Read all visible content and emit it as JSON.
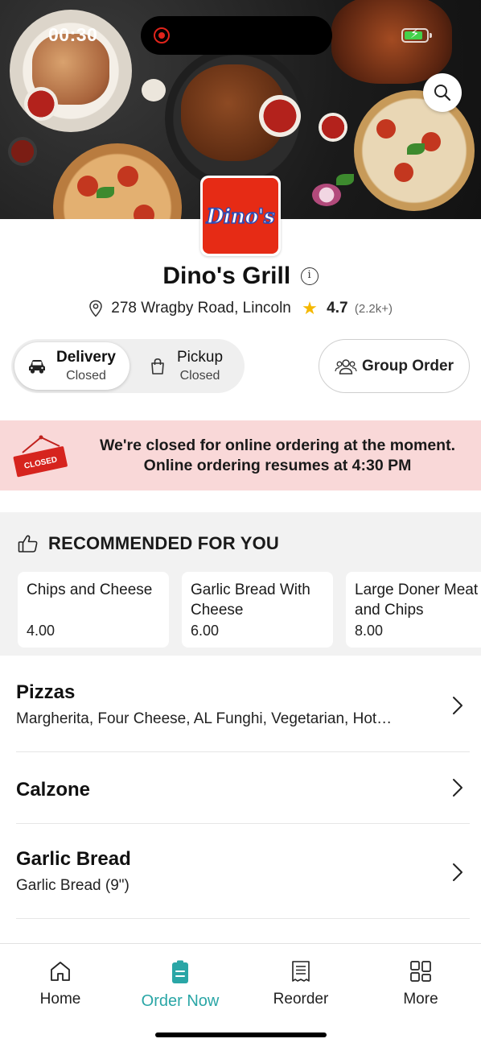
{
  "status_bar": {
    "time": "00:30"
  },
  "restaurant": {
    "name": "Dino's Grill",
    "logo_text": "Dino's",
    "address": "278 Wragby Road, Lincoln",
    "rating": "4.7",
    "rating_count": "(2.2k+)"
  },
  "order_mode": {
    "delivery": {
      "label": "Delivery",
      "status": "Closed",
      "selected": true
    },
    "pickup": {
      "label": "Pickup",
      "status": "Closed",
      "selected": false
    }
  },
  "group_order": {
    "label": "Group Order"
  },
  "closed_banner": {
    "sign_text": "CLOSED",
    "line1": "We're closed for online ordering at the moment.",
    "line2": "Online ordering resumes at 4:30 PM"
  },
  "recommended": {
    "title": "RECOMMENDED FOR YOU",
    "items": [
      {
        "name": "Chips and Cheese",
        "price": "4.00"
      },
      {
        "name": "Garlic Bread With Cheese",
        "price": "6.00"
      },
      {
        "name": "Large Doner Meat and Chips",
        "price": "8.00"
      }
    ]
  },
  "categories": [
    {
      "name": "Pizzas",
      "description": "Margherita, Four Cheese, AL Funghi, Vegetarian, Hot…"
    },
    {
      "name": "Calzone",
      "description": ""
    },
    {
      "name": "Garlic Bread",
      "description": "Garlic Bread (9\")"
    }
  ],
  "bottom_nav": {
    "items": [
      {
        "label": "Home",
        "icon": "home-icon",
        "active": false
      },
      {
        "label": "Order Now",
        "icon": "order-icon",
        "active": true
      },
      {
        "label": "Reorder",
        "icon": "receipt-icon",
        "active": false
      },
      {
        "label": "More",
        "icon": "grid-icon",
        "active": false
      }
    ]
  },
  "colors": {
    "accent": "#2aa6a6",
    "banner_bg": "#f9d8d8",
    "star": "#f5b800",
    "logo_red": "#e62b15"
  }
}
